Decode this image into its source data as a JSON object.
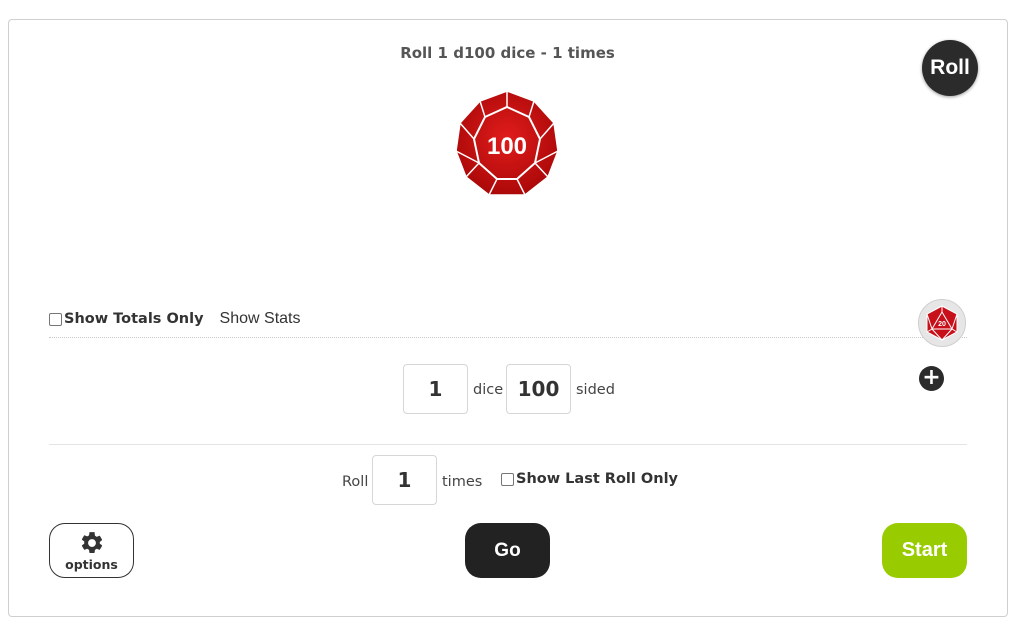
{
  "header": {
    "title": "Roll 1 d100 dice - 1 times"
  },
  "roll_button": {
    "label": "Roll"
  },
  "result": {
    "die_value": "100",
    "die_color": "#cc1111"
  },
  "filters": {
    "show_totals_only": {
      "label": "Show Totals Only",
      "checked": false
    },
    "show_stats": {
      "label": "Show Stats"
    }
  },
  "dice_config": {
    "count": "1",
    "count_label": "dice",
    "sides": "100",
    "sides_label": "sided",
    "add_icon": "plus-circle-icon",
    "die_icon": "d20-icon",
    "die_icon_text": "20"
  },
  "roll_config": {
    "roll_label": "Roll",
    "times": "1",
    "times_label": "times",
    "show_last_roll_only": {
      "label": "Show Last Roll Only",
      "checked": false
    }
  },
  "footer": {
    "options_label": "options",
    "options_icon": "gear-icon",
    "go_label": "Go",
    "start_label": "Start",
    "start_color": "#99cc00"
  }
}
